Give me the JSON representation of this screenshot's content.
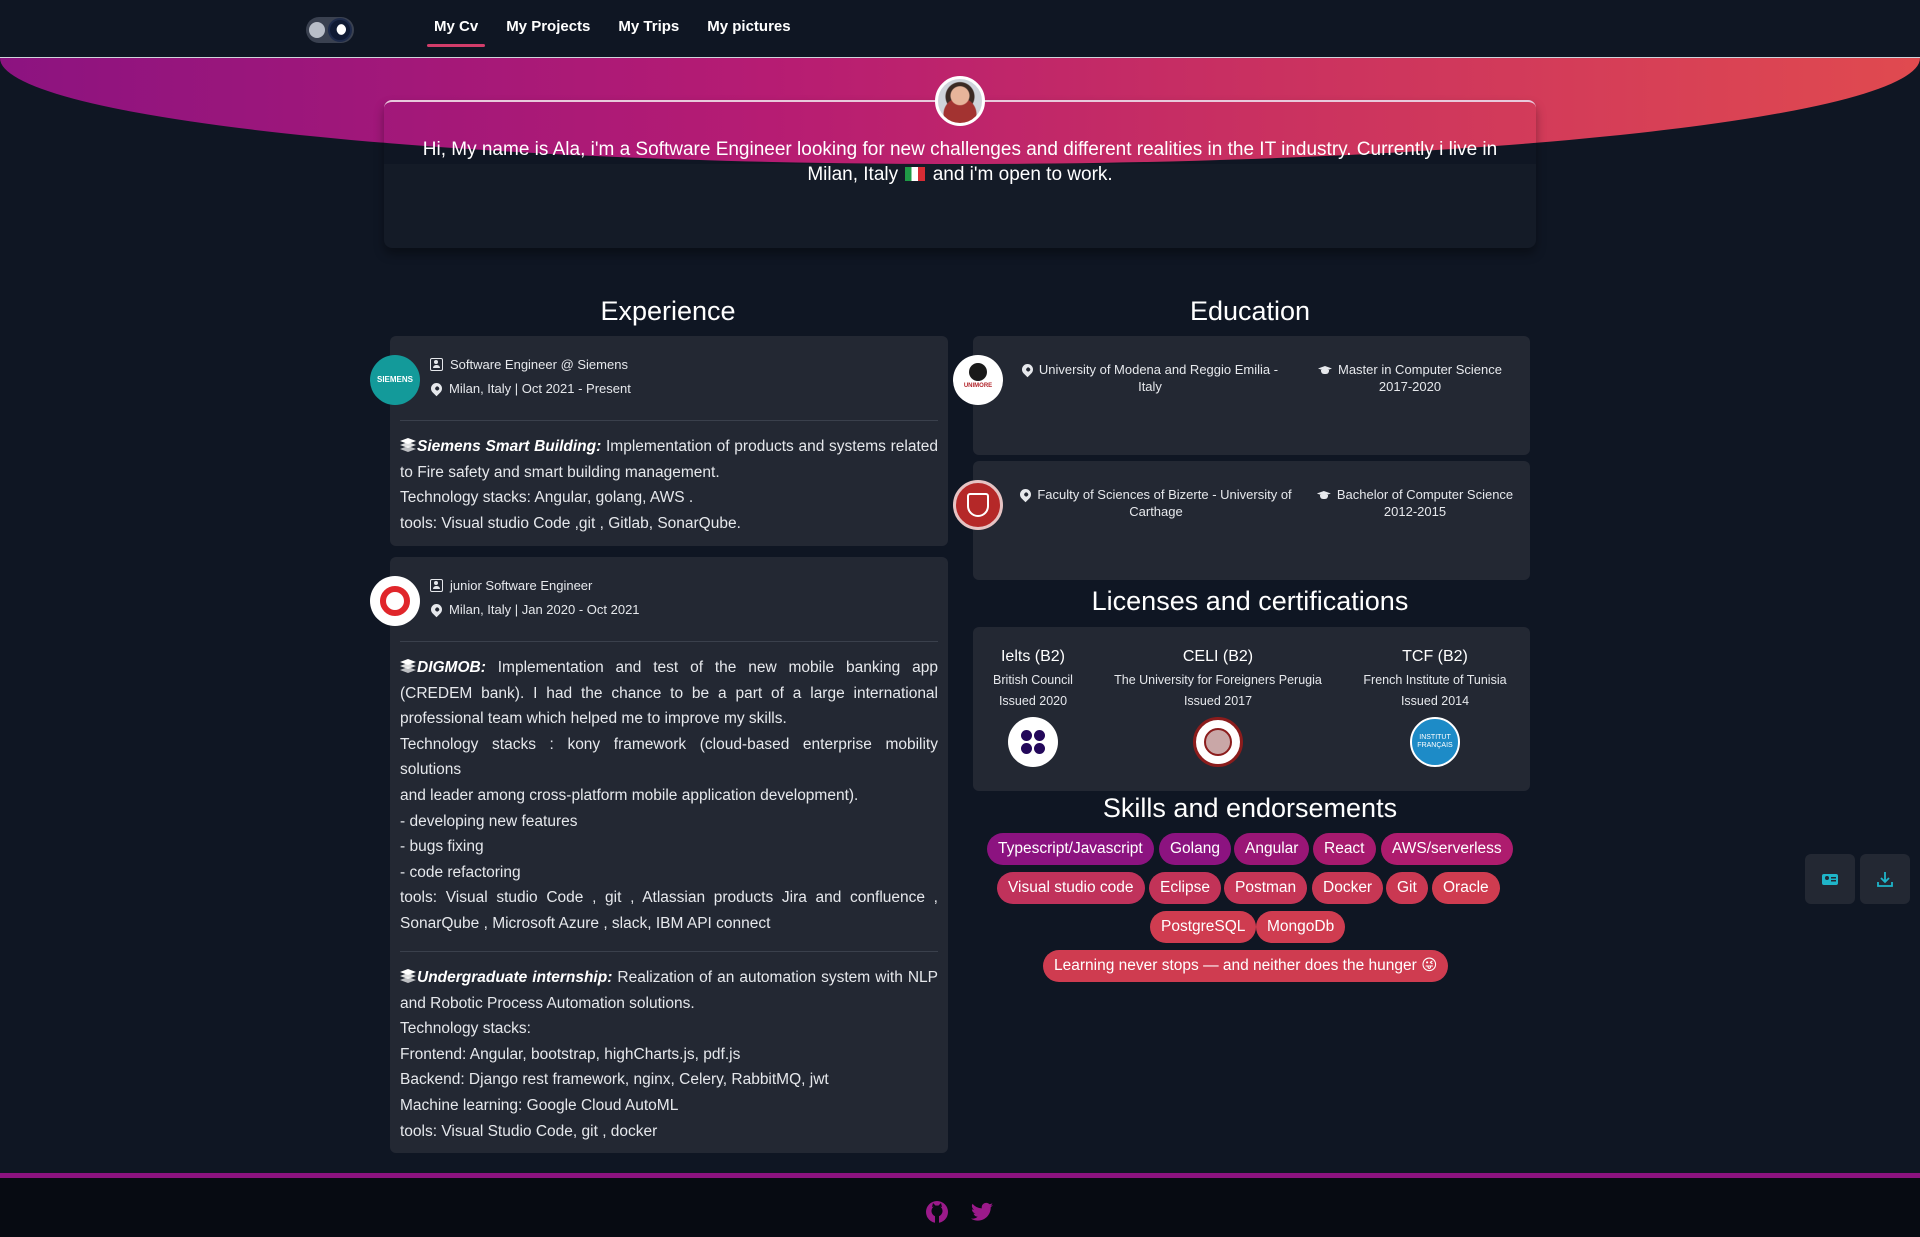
{
  "nav": {
    "items": [
      "My Cv",
      "My Projects",
      "My Trips",
      "My pictures"
    ]
  },
  "hero": {
    "text_before_flag": "Hi, My name is Ala, i'm a Software Engineer looking for new challenges and different realities in the IT industry. Currently i live in Milan, Italy",
    "text_after_flag": "and i'm open to work."
  },
  "experience": {
    "title": "Experience",
    "jobs": [
      {
        "logo_text": "SIEMENS",
        "role": "Software Engineer @ Siemens",
        "location": "Milan, Italy | Oct 2021 - Present",
        "projects": [
          {
            "name": "Siemens Smart Building:",
            "lines": [
              "Implementation of products and systems related to Fire safety and smart building management.",
              "Technology stacks: Angular, golang, AWS .",
              "tools: Visual studio Code ,git , Gitlab, SonarQube."
            ]
          }
        ]
      },
      {
        "role": "junior Software Engineer",
        "location": "Milan, Italy | Jan 2020 - Oct 2021",
        "projects": [
          {
            "name": "DIGMOB:",
            "lines": [
              "Implementation and test of the new mobile banking app (CREDEM bank). I had the chance to be a part of a large international professional team which helped me to improve my skills.",
              "Technology stacks : kony framework (cloud-based enterprise mobility solutions",
              "and leader among cross-platform mobile application development).",
              "- developing new features",
              "- bugs fixing",
              "- code refactoring",
              "tools: Visual studio Code , git , Atlassian products Jira and confluence , SonarQube , Microsoft Azure , slack, IBM API connect"
            ]
          },
          {
            "name": "Undergraduate internship:",
            "lines": [
              "Realization of an automation system with NLP and Robotic Process Automation solutions.",
              "Technology stacks:",
              "Frontend: Angular, bootstrap, highCharts.js, pdf.js",
              "Backend: Django rest framework, nginx, Celery, RabbitMQ, jwt",
              "Machine learning: Google Cloud AutoML",
              "tools: Visual Studio Code, git , docker"
            ]
          }
        ]
      }
    ]
  },
  "education": {
    "title": "Education",
    "items": [
      {
        "logo_text": "UNIMORE",
        "school": "University of Modena and Reggio Emilia - Italy",
        "degree": "Master in Computer Science",
        "years": "2017-2020"
      },
      {
        "school": "Faculty of Sciences of Bizerte - University of Carthage",
        "degree": "Bachelor of Computer Science",
        "years": "2012-2015"
      }
    ]
  },
  "certifications": {
    "title": "Licenses and certifications",
    "items": [
      {
        "name": "Ielts (B2)",
        "issuer": "British Council",
        "issued": "Issued 2020"
      },
      {
        "name": "CELI (B2)",
        "issuer": "The University for Foreigners Perugia",
        "issued": "Issued 2017"
      },
      {
        "name": "TCF (B2)",
        "issuer": "French Institute of Tunisia",
        "issued": "Issued 2014",
        "logo_text": "INSTITUT FRANÇAIS"
      }
    ]
  },
  "skills": {
    "title": "Skills and endorsements",
    "chips": [
      "Typescript/Javascript",
      "Golang",
      "Angular",
      "React",
      "AWS/serverless",
      "Visual studio code",
      "Eclipse",
      "Postman",
      "Docker",
      "Git",
      "Oracle",
      "PostgreSQL",
      "MongoDb"
    ],
    "motto": "Learning never stops — and neither does the hunger 😜"
  },
  "colors": {
    "background": "#0f1623",
    "card": "#232833",
    "gradient_start": "#8c1380",
    "gradient_end": "#e04a4f",
    "accent_underline": "#d23d6a"
  },
  "icons": [
    "theme-toggle-icon",
    "avatar",
    "briefcase-icon",
    "location-pin-icon",
    "graduation-cap-icon",
    "layers-icon",
    "contact-card-icon",
    "download-icon",
    "github-icon",
    "twitter-icon"
  ]
}
